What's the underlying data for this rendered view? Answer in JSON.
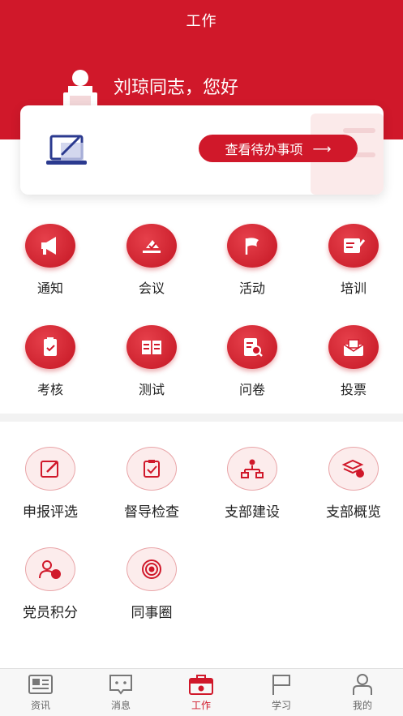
{
  "header": {
    "title": "工作",
    "greeting": "刘琼同志，您好"
  },
  "todo": {
    "button_label": "查看待办事项",
    "arrow": "⟶"
  },
  "grid_primary": [
    {
      "label": "通知",
      "icon": "megaphone-icon"
    },
    {
      "label": "会议",
      "icon": "meeting-check-icon"
    },
    {
      "label": "活动",
      "icon": "flag-icon"
    },
    {
      "label": "培训",
      "icon": "training-icon"
    },
    {
      "label": "考核",
      "icon": "clipboard-check-icon"
    },
    {
      "label": "测试",
      "icon": "open-book-icon"
    },
    {
      "label": "问卷",
      "icon": "questionnaire-icon"
    },
    {
      "label": "投票",
      "icon": "vote-box-icon"
    }
  ],
  "grid_secondary": [
    {
      "label": "申报评选",
      "icon": "edit-icon"
    },
    {
      "label": "督导检查",
      "icon": "inspect-check-icon"
    },
    {
      "label": "支部建设",
      "icon": "org-structure-icon"
    },
    {
      "label": "支部概览",
      "icon": "layers-icon"
    },
    {
      "label": "党员积分",
      "icon": "member-points-icon"
    },
    {
      "label": "同事圈",
      "icon": "colleague-circle-icon"
    }
  ],
  "tabbar": [
    {
      "label": "资讯",
      "icon": "news-icon",
      "active": false
    },
    {
      "label": "消息",
      "icon": "message-icon",
      "active": false
    },
    {
      "label": "工作",
      "icon": "briefcase-icon",
      "active": true
    },
    {
      "label": "学习",
      "icon": "study-flag-icon",
      "active": false
    },
    {
      "label": "我的",
      "icon": "profile-icon",
      "active": false
    }
  ],
  "colors": {
    "primary": "#d0182a",
    "soft_bg": "#fcecec",
    "tab_inactive": "#666666"
  }
}
